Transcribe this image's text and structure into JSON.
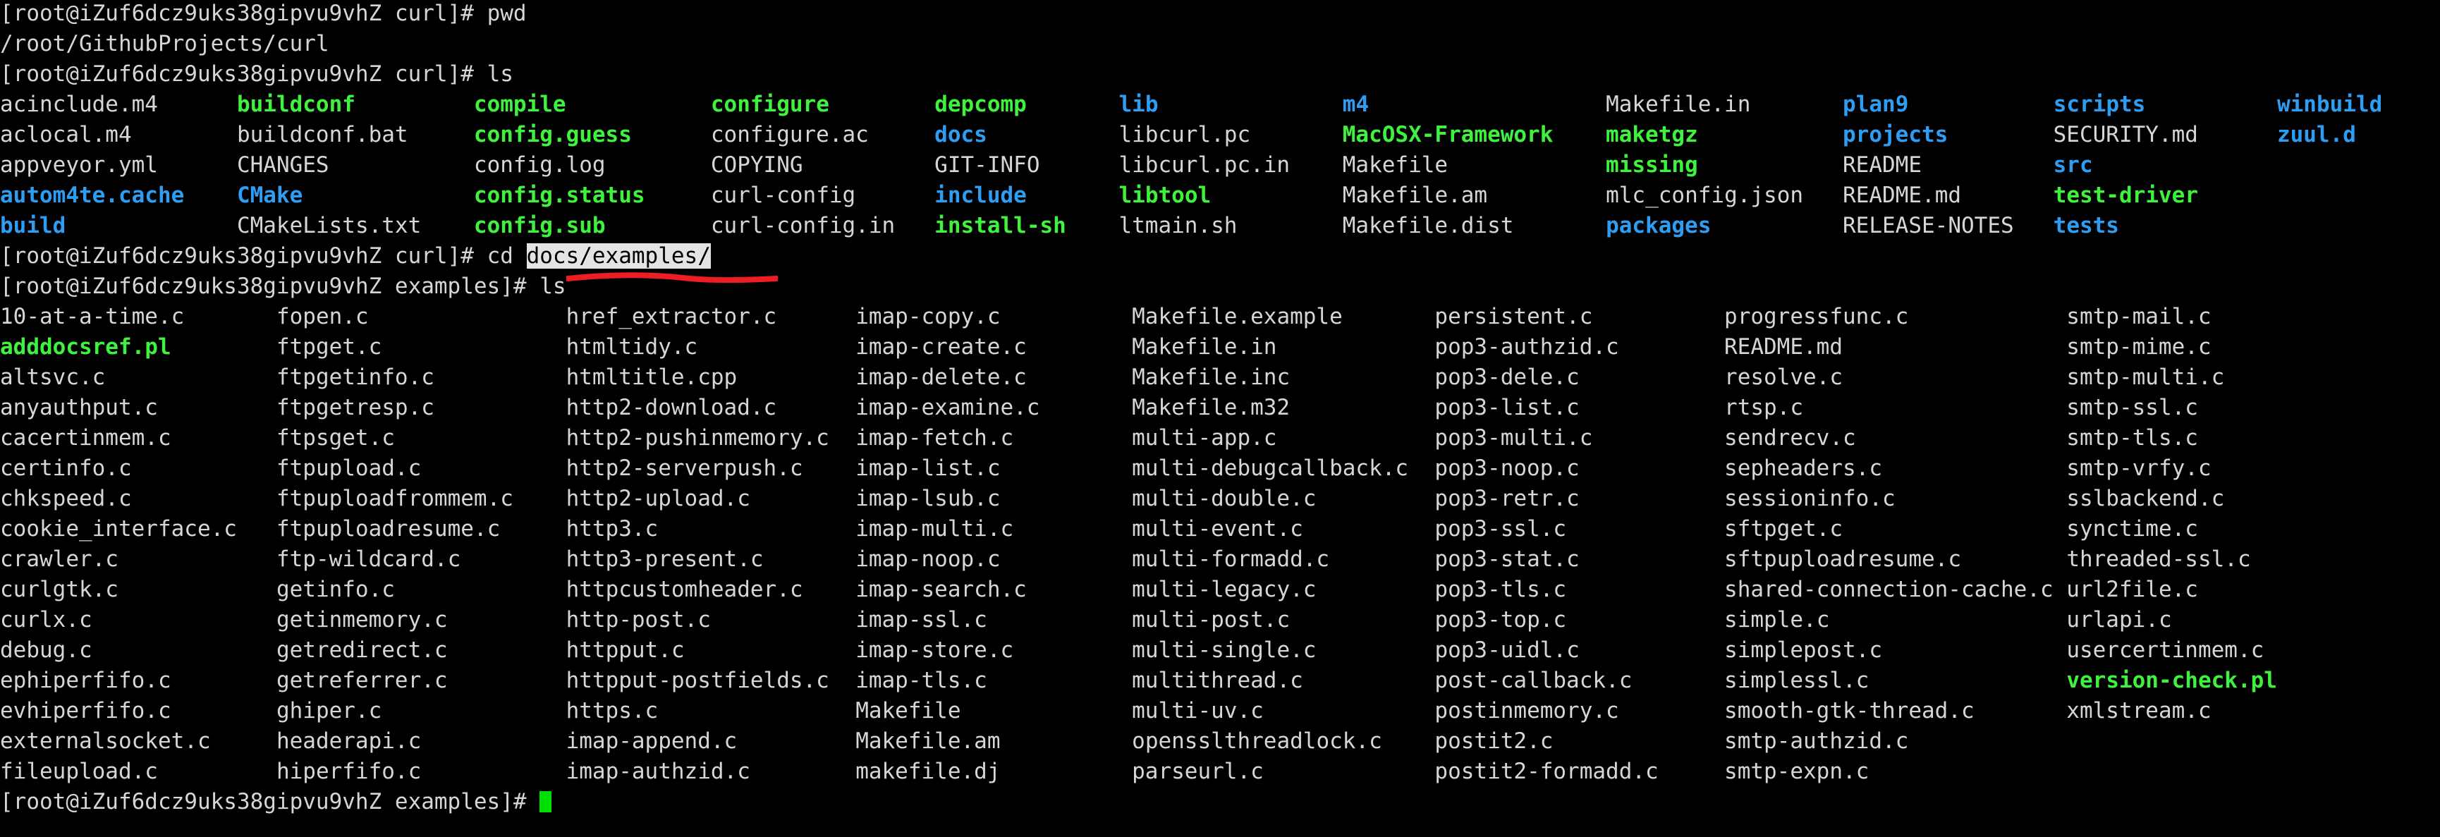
{
  "terminal": {
    "prompt_curl": "[root@iZuf6dcz9uks38gipvu9vhZ curl]# ",
    "prompt_examples": "[root@iZuf6dcz9uks38gipvu9vhZ examples]# ",
    "commands": {
      "pwd": "pwd",
      "ls": "ls",
      "cd_prefix": "cd ",
      "cd_argument": "docs/examples/"
    },
    "pwd_output": "/root/GithubProjects/curl",
    "colors": {
      "background": "#000000",
      "foreground": "#d6d6d6",
      "executable_green": "#3ef23e",
      "directory_blue": "#2e9ef4",
      "selection_background": "#e4e4e4",
      "selection_foreground": "#000000",
      "cursor_green": "#00e000",
      "annotation_red": "#ee1c25"
    },
    "curl_ls_rows": [
      [
        {
          "t": "acinclude.m4",
          "c": "w",
          "w": 18
        },
        {
          "t": "buildconf",
          "c": "g",
          "w": 18
        },
        {
          "t": "compile",
          "c": "g",
          "w": 18
        },
        {
          "t": "configure",
          "c": "g",
          "w": 17
        },
        {
          "t": "depcomp",
          "c": "g",
          "w": 14
        },
        {
          "t": "lib",
          "c": "b",
          "w": 17
        },
        {
          "t": "m4",
          "c": "b",
          "w": 20
        },
        {
          "t": "Makefile.in",
          "c": "w",
          "w": 18
        },
        {
          "t": "plan9",
          "c": "b",
          "w": 16
        },
        {
          "t": "scripts",
          "c": "b",
          "w": 17
        },
        {
          "t": "winbuild",
          "c": "b",
          "w": 0
        }
      ],
      [
        {
          "t": "aclocal.m4",
          "c": "w",
          "w": 18
        },
        {
          "t": "buildconf.bat",
          "c": "w",
          "w": 18
        },
        {
          "t": "config.guess",
          "c": "g",
          "w": 18
        },
        {
          "t": "configure.ac",
          "c": "w",
          "w": 17
        },
        {
          "t": "docs",
          "c": "b",
          "w": 14
        },
        {
          "t": "libcurl.pc",
          "c": "w",
          "w": 17
        },
        {
          "t": "MacOSX-Framework",
          "c": "g",
          "w": 20
        },
        {
          "t": "maketgz",
          "c": "g",
          "w": 18
        },
        {
          "t": "projects",
          "c": "b",
          "w": 16
        },
        {
          "t": "SECURITY.md",
          "c": "w",
          "w": 17
        },
        {
          "t": "zuul.d",
          "c": "b",
          "w": 0
        }
      ],
      [
        {
          "t": "appveyor.yml",
          "c": "w",
          "w": 18
        },
        {
          "t": "CHANGES",
          "c": "w",
          "w": 18
        },
        {
          "t": "config.log",
          "c": "w",
          "w": 18
        },
        {
          "t": "COPYING",
          "c": "w",
          "w": 17
        },
        {
          "t": "GIT-INFO",
          "c": "w",
          "w": 14
        },
        {
          "t": "libcurl.pc.in",
          "c": "w",
          "w": 17
        },
        {
          "t": "Makefile",
          "c": "w",
          "w": 20
        },
        {
          "t": "missing",
          "c": "g",
          "w": 18
        },
        {
          "t": "README",
          "c": "w",
          "w": 16
        },
        {
          "t": "src",
          "c": "b",
          "w": 0
        }
      ],
      [
        {
          "t": "autom4te.cache",
          "c": "b",
          "w": 18
        },
        {
          "t": "CMake",
          "c": "b",
          "w": 18
        },
        {
          "t": "config.status",
          "c": "g",
          "w": 18
        },
        {
          "t": "curl-config",
          "c": "w",
          "w": 17
        },
        {
          "t": "include",
          "c": "b",
          "w": 14
        },
        {
          "t": "libtool",
          "c": "g",
          "w": 17
        },
        {
          "t": "Makefile.am",
          "c": "w",
          "w": 20
        },
        {
          "t": "mlc_config.json",
          "c": "w",
          "w": 18
        },
        {
          "t": "README.md",
          "c": "w",
          "w": 16
        },
        {
          "t": "test-driver",
          "c": "g",
          "w": 0
        }
      ],
      [
        {
          "t": "build",
          "c": "b",
          "w": 18
        },
        {
          "t": "CMakeLists.txt",
          "c": "w",
          "w": 18
        },
        {
          "t": "config.sub",
          "c": "g",
          "w": 18
        },
        {
          "t": "curl-config.in",
          "c": "w",
          "w": 17
        },
        {
          "t": "install-sh",
          "c": "g",
          "w": 14
        },
        {
          "t": "ltmain.sh",
          "c": "w",
          "w": 17
        },
        {
          "t": "Makefile.dist",
          "c": "w",
          "w": 20
        },
        {
          "t": "packages",
          "c": "b",
          "w": 18
        },
        {
          "t": "RELEASE-NOTES",
          "c": "w",
          "w": 16
        },
        {
          "t": "tests",
          "c": "b",
          "w": 0
        }
      ]
    ],
    "examples_ls_rows": [
      [
        {
          "t": "10-at-a-time.c",
          "c": "w",
          "w": 21
        },
        {
          "t": "fopen.c",
          "c": "w",
          "w": 22
        },
        {
          "t": "href_extractor.c",
          "c": "w",
          "w": 22
        },
        {
          "t": "imap-copy.c",
          "c": "w",
          "w": 21
        },
        {
          "t": "Makefile.example",
          "c": "w",
          "w": 23
        },
        {
          "t": "persistent.c",
          "c": "w",
          "w": 22
        },
        {
          "t": "progressfunc.c",
          "c": "w",
          "w": 26
        },
        {
          "t": "smtp-mail.c",
          "c": "w",
          "w": 0
        }
      ],
      [
        {
          "t": "adddocsref.pl",
          "c": "g",
          "w": 21
        },
        {
          "t": "ftpget.c",
          "c": "w",
          "w": 22
        },
        {
          "t": "htmltidy.c",
          "c": "w",
          "w": 22
        },
        {
          "t": "imap-create.c",
          "c": "w",
          "w": 21
        },
        {
          "t": "Makefile.in",
          "c": "w",
          "w": 23
        },
        {
          "t": "pop3-authzid.c",
          "c": "w",
          "w": 22
        },
        {
          "t": "README.md",
          "c": "w",
          "w": 26
        },
        {
          "t": "smtp-mime.c",
          "c": "w",
          "w": 0
        }
      ],
      [
        {
          "t": "altsvc.c",
          "c": "w",
          "w": 21
        },
        {
          "t": "ftpgetinfo.c",
          "c": "w",
          "w": 22
        },
        {
          "t": "htmltitle.cpp",
          "c": "w",
          "w": 22
        },
        {
          "t": "imap-delete.c",
          "c": "w",
          "w": 21
        },
        {
          "t": "Makefile.inc",
          "c": "w",
          "w": 23
        },
        {
          "t": "pop3-dele.c",
          "c": "w",
          "w": 22
        },
        {
          "t": "resolve.c",
          "c": "w",
          "w": 26
        },
        {
          "t": "smtp-multi.c",
          "c": "w",
          "w": 0
        }
      ],
      [
        {
          "t": "anyauthput.c",
          "c": "w",
          "w": 21
        },
        {
          "t": "ftpgetresp.c",
          "c": "w",
          "w": 22
        },
        {
          "t": "http2-download.c",
          "c": "w",
          "w": 22
        },
        {
          "t": "imap-examine.c",
          "c": "w",
          "w": 21
        },
        {
          "t": "Makefile.m32",
          "c": "w",
          "w": 23
        },
        {
          "t": "pop3-list.c",
          "c": "w",
          "w": 22
        },
        {
          "t": "rtsp.c",
          "c": "w",
          "w": 26
        },
        {
          "t": "smtp-ssl.c",
          "c": "w",
          "w": 0
        }
      ],
      [
        {
          "t": "cacertinmem.c",
          "c": "w",
          "w": 21
        },
        {
          "t": "ftpsget.c",
          "c": "w",
          "w": 22
        },
        {
          "t": "http2-pushinmemory.c",
          "c": "w",
          "w": 22
        },
        {
          "t": "imap-fetch.c",
          "c": "w",
          "w": 21
        },
        {
          "t": "multi-app.c",
          "c": "w",
          "w": 23
        },
        {
          "t": "pop3-multi.c",
          "c": "w",
          "w": 22
        },
        {
          "t": "sendrecv.c",
          "c": "w",
          "w": 26
        },
        {
          "t": "smtp-tls.c",
          "c": "w",
          "w": 0
        }
      ],
      [
        {
          "t": "certinfo.c",
          "c": "w",
          "w": 21
        },
        {
          "t": "ftpupload.c",
          "c": "w",
          "w": 22
        },
        {
          "t": "http2-serverpush.c",
          "c": "w",
          "w": 22
        },
        {
          "t": "imap-list.c",
          "c": "w",
          "w": 21
        },
        {
          "t": "multi-debugcallback.c",
          "c": "w",
          "w": 23
        },
        {
          "t": "pop3-noop.c",
          "c": "w",
          "w": 22
        },
        {
          "t": "sepheaders.c",
          "c": "w",
          "w": 26
        },
        {
          "t": "smtp-vrfy.c",
          "c": "w",
          "w": 0
        }
      ],
      [
        {
          "t": "chkspeed.c",
          "c": "w",
          "w": 21
        },
        {
          "t": "ftpuploadfrommem.c",
          "c": "w",
          "w": 22
        },
        {
          "t": "http2-upload.c",
          "c": "w",
          "w": 22
        },
        {
          "t": "imap-lsub.c",
          "c": "w",
          "w": 21
        },
        {
          "t": "multi-double.c",
          "c": "w",
          "w": 23
        },
        {
          "t": "pop3-retr.c",
          "c": "w",
          "w": 22
        },
        {
          "t": "sessioninfo.c",
          "c": "w",
          "w": 26
        },
        {
          "t": "sslbackend.c",
          "c": "w",
          "w": 0
        }
      ],
      [
        {
          "t": "cookie_interface.c",
          "c": "w",
          "w": 21
        },
        {
          "t": "ftpuploadresume.c",
          "c": "w",
          "w": 22
        },
        {
          "t": "http3.c",
          "c": "w",
          "w": 22
        },
        {
          "t": "imap-multi.c",
          "c": "w",
          "w": 21
        },
        {
          "t": "multi-event.c",
          "c": "w",
          "w": 23
        },
        {
          "t": "pop3-ssl.c",
          "c": "w",
          "w": 22
        },
        {
          "t": "sftpget.c",
          "c": "w",
          "w": 26
        },
        {
          "t": "synctime.c",
          "c": "w",
          "w": 0
        }
      ],
      [
        {
          "t": "crawler.c",
          "c": "w",
          "w": 21
        },
        {
          "t": "ftp-wildcard.c",
          "c": "w",
          "w": 22
        },
        {
          "t": "http3-present.c",
          "c": "w",
          "w": 22
        },
        {
          "t": "imap-noop.c",
          "c": "w",
          "w": 21
        },
        {
          "t": "multi-formadd.c",
          "c": "w",
          "w": 23
        },
        {
          "t": "pop3-stat.c",
          "c": "w",
          "w": 22
        },
        {
          "t": "sftpuploadresume.c",
          "c": "w",
          "w": 26
        },
        {
          "t": "threaded-ssl.c",
          "c": "w",
          "w": 0
        }
      ],
      [
        {
          "t": "curlgtk.c",
          "c": "w",
          "w": 21
        },
        {
          "t": "getinfo.c",
          "c": "w",
          "w": 22
        },
        {
          "t": "httpcustomheader.c",
          "c": "w",
          "w": 22
        },
        {
          "t": "imap-search.c",
          "c": "w",
          "w": 21
        },
        {
          "t": "multi-legacy.c",
          "c": "w",
          "w": 23
        },
        {
          "t": "pop3-tls.c",
          "c": "w",
          "w": 22
        },
        {
          "t": "shared-connection-cache.c",
          "c": "w",
          "w": 26
        },
        {
          "t": "url2file.c",
          "c": "w",
          "w": 0
        }
      ],
      [
        {
          "t": "curlx.c",
          "c": "w",
          "w": 21
        },
        {
          "t": "getinmemory.c",
          "c": "w",
          "w": 22
        },
        {
          "t": "http-post.c",
          "c": "w",
          "w": 22
        },
        {
          "t": "imap-ssl.c",
          "c": "w",
          "w": 21
        },
        {
          "t": "multi-post.c",
          "c": "w",
          "w": 23
        },
        {
          "t": "pop3-top.c",
          "c": "w",
          "w": 22
        },
        {
          "t": "simple.c",
          "c": "w",
          "w": 26
        },
        {
          "t": "urlapi.c",
          "c": "w",
          "w": 0
        }
      ],
      [
        {
          "t": "debug.c",
          "c": "w",
          "w": 21
        },
        {
          "t": "getredirect.c",
          "c": "w",
          "w": 22
        },
        {
          "t": "httpput.c",
          "c": "w",
          "w": 22
        },
        {
          "t": "imap-store.c",
          "c": "w",
          "w": 21
        },
        {
          "t": "multi-single.c",
          "c": "w",
          "w": 23
        },
        {
          "t": "pop3-uidl.c",
          "c": "w",
          "w": 22
        },
        {
          "t": "simplepost.c",
          "c": "w",
          "w": 26
        },
        {
          "t": "usercertinmem.c",
          "c": "w",
          "w": 0
        }
      ],
      [
        {
          "t": "ephiperfifo.c",
          "c": "w",
          "w": 21
        },
        {
          "t": "getreferrer.c",
          "c": "w",
          "w": 22
        },
        {
          "t": "httpput-postfields.c",
          "c": "w",
          "w": 22
        },
        {
          "t": "imap-tls.c",
          "c": "w",
          "w": 21
        },
        {
          "t": "multithread.c",
          "c": "w",
          "w": 23
        },
        {
          "t": "post-callback.c",
          "c": "w",
          "w": 22
        },
        {
          "t": "simplessl.c",
          "c": "w",
          "w": 26
        },
        {
          "t": "version-check.pl",
          "c": "g",
          "w": 0
        }
      ],
      [
        {
          "t": "evhiperfifo.c",
          "c": "w",
          "w": 21
        },
        {
          "t": "ghiper.c",
          "c": "w",
          "w": 22
        },
        {
          "t": "https.c",
          "c": "w",
          "w": 22
        },
        {
          "t": "Makefile",
          "c": "w",
          "w": 21
        },
        {
          "t": "multi-uv.c",
          "c": "w",
          "w": 23
        },
        {
          "t": "postinmemory.c",
          "c": "w",
          "w": 22
        },
        {
          "t": "smooth-gtk-thread.c",
          "c": "w",
          "w": 26
        },
        {
          "t": "xmlstream.c",
          "c": "w",
          "w": 0
        }
      ],
      [
        {
          "t": "externalsocket.c",
          "c": "w",
          "w": 21
        },
        {
          "t": "headerapi.c",
          "c": "w",
          "w": 22
        },
        {
          "t": "imap-append.c",
          "c": "w",
          "w": 22
        },
        {
          "t": "Makefile.am",
          "c": "w",
          "w": 21
        },
        {
          "t": "opensslthreadlock.c",
          "c": "w",
          "w": 23
        },
        {
          "t": "postit2.c",
          "c": "w",
          "w": 22
        },
        {
          "t": "smtp-authzid.c",
          "c": "w",
          "w": 0
        }
      ],
      [
        {
          "t": "fileupload.c",
          "c": "w",
          "w": 21
        },
        {
          "t": "hiperfifo.c",
          "c": "w",
          "w": 22
        },
        {
          "t": "imap-authzid.c",
          "c": "w",
          "w": 22
        },
        {
          "t": "makefile.dj",
          "c": "w",
          "w": 21
        },
        {
          "t": "parseurl.c",
          "c": "w",
          "w": 23
        },
        {
          "t": "postit2-formadd.c",
          "c": "w",
          "w": 22
        },
        {
          "t": "smtp-expn.c",
          "c": "w",
          "w": 0
        }
      ]
    ]
  }
}
